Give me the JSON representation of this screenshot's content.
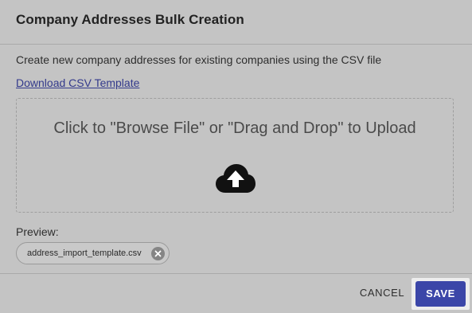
{
  "dialog": {
    "title": "Company Addresses Bulk Creation",
    "description": "Create new company addresses for existing companies using the CSV file",
    "download_link": "Download CSV Template",
    "dropzone_text": "Click to \"Browse File\" or \"Drag and Drop\" to Upload",
    "upload_icon": "cloud-upload-icon",
    "preview_label": "Preview:",
    "file_chip": {
      "filename": "address_import_template.csv",
      "remove_icon": "close-circle-icon"
    },
    "footer": {
      "cancel_label": "CANCEL",
      "save_label": "SAVE"
    }
  },
  "colors": {
    "overlay_background": "#c4c4c4",
    "primary_button": "#3b46a8",
    "link": "#333a8c"
  }
}
